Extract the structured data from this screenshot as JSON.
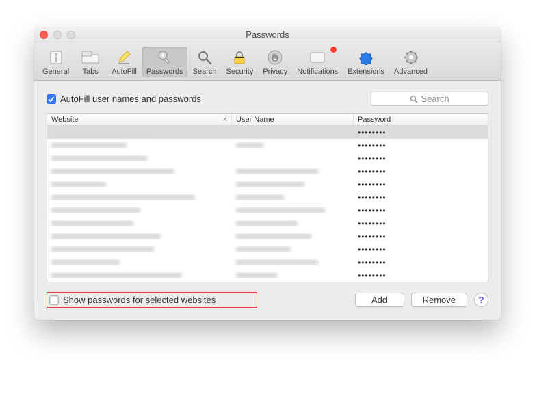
{
  "window": {
    "title": "Passwords"
  },
  "toolbar": {
    "items": [
      {
        "id": "general",
        "label": "General"
      },
      {
        "id": "tabs",
        "label": "Tabs"
      },
      {
        "id": "autofill",
        "label": "AutoFill"
      },
      {
        "id": "passwords",
        "label": "Passwords",
        "active": true
      },
      {
        "id": "search",
        "label": "Search"
      },
      {
        "id": "security",
        "label": "Security"
      },
      {
        "id": "privacy",
        "label": "Privacy"
      },
      {
        "id": "notifications",
        "label": "Notifications",
        "badge": true
      },
      {
        "id": "extensions",
        "label": "Extensions"
      },
      {
        "id": "advanced",
        "label": "Advanced"
      }
    ]
  },
  "autofill_check": {
    "checked": true,
    "label": "AutoFill user names and passwords"
  },
  "search": {
    "placeholder": "Search"
  },
  "table": {
    "columns": {
      "website": "Website",
      "user": "User Name",
      "password": "Password"
    },
    "sort": {
      "column": "website",
      "dir": "asc"
    },
    "rows": [
      {
        "selected": true,
        "password": "••••••••"
      },
      {
        "password": "••••••••"
      },
      {
        "password": "••••••••"
      },
      {
        "password": "••••••••"
      },
      {
        "password": "••••••••"
      },
      {
        "password": "••••••••"
      },
      {
        "password": "••••••••"
      },
      {
        "password": "••••••••"
      },
      {
        "password": "••••••••"
      },
      {
        "password": "••••••••"
      },
      {
        "password": "••••••••"
      },
      {
        "password": "••••••••"
      }
    ]
  },
  "show_passwords": {
    "checked": false,
    "label": "Show passwords for selected websites"
  },
  "buttons": {
    "add": "Add",
    "remove": "Remove"
  },
  "help": "?"
}
